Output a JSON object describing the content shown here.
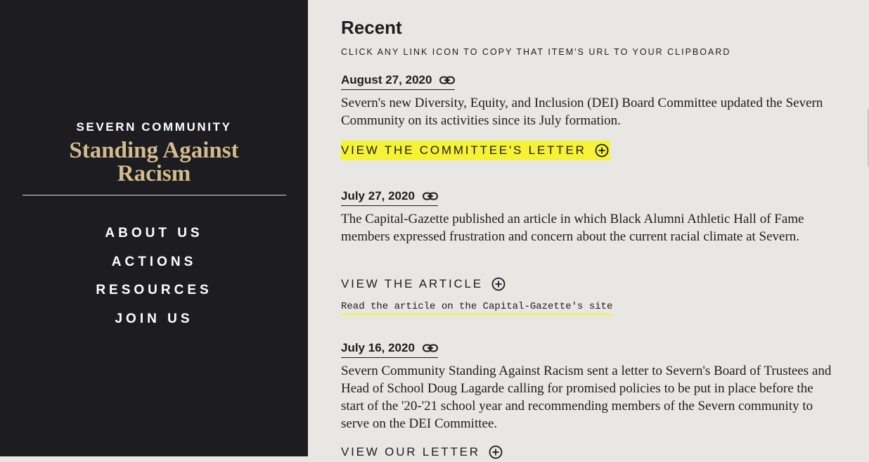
{
  "sidebar": {
    "kicker": "SEVERN COMMUNITY",
    "title_line1": "Standing Against",
    "title_line2": "Racism",
    "nav": [
      {
        "label": "ABOUT US"
      },
      {
        "label": "ACTIONS"
      },
      {
        "label": "RESOURCES"
      },
      {
        "label": "JOIN US"
      }
    ]
  },
  "main": {
    "title": "Recent",
    "subtitle": "CLICK ANY LINK ICON TO COPY THAT ITEM'S URL TO YOUR CLIPBOARD",
    "entries": [
      {
        "date": "August 27, 2020",
        "text": "Severn's new Diversity, Equity, and Inclusion (DEI) Board Committee updated the Severn Community on its activities since its July formation.",
        "cta": "VIEW THE COMMITTEE'S LETTER"
      },
      {
        "date": "July 27, 2020",
        "text": "The Capital-Gazette published an article in which Black Alumni Athletic Hall of Fame members expressed frustration and concern about the current racial climate at Severn.",
        "cta": "VIEW THE ARTICLE",
        "sublink": "Read the article on the Capital-Gazette's site"
      },
      {
        "date": "July 16, 2020",
        "text": "Severn Community Standing Against Racism sent a letter to Severn's Board of Trustees and Head of School Doug Lagarde calling for promised policies to be put in place before the start of the '20-'21 school year and recommending members of the Severn community to serve on the DEI Committee.",
        "cta": "VIEW OUR LETTER"
      }
    ]
  },
  "colors": {
    "sidebar_bg": "#1d1c21",
    "accent_gold": "#d3bb8c",
    "highlight_yellow": "#f6f336",
    "page_bg": "#e9e7e3"
  },
  "icons": {
    "date_link": "link-icon",
    "cta_expand": "plus-circle-icon"
  }
}
